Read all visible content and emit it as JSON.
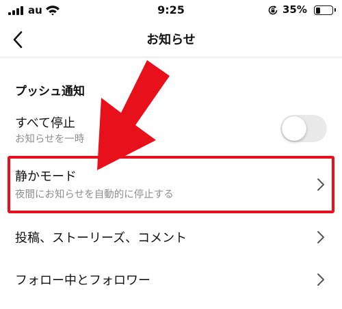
{
  "status_bar": {
    "carrier": "au",
    "time": "9:25",
    "battery_percent": "35%",
    "battery_level": 0.35,
    "icons": [
      "signal-icon",
      "wifi-icon",
      "orientation-lock-icon",
      "battery-icon"
    ]
  },
  "nav": {
    "title": "お知らせ",
    "back_icon": "chevron-left-icon"
  },
  "section": {
    "title": "プッシュ通知"
  },
  "rows": {
    "stop_all": {
      "title": "すべて停止",
      "subtitle": "お知らせを一時",
      "toggle_on": false
    },
    "quiet_mode": {
      "title": "静かモード",
      "subtitle": "夜間にお知らせを自動的に停止する"
    },
    "posts": {
      "title": "投稿、ストーリーズ、コメント"
    },
    "following": {
      "title": "フォロー中とフォロワー"
    }
  },
  "colors": {
    "annotation_red": "#e8101a",
    "toggle_off": "#e9e9ea",
    "subtitle_gray": "#8e8e8e",
    "chevron_gray": "#555555"
  }
}
